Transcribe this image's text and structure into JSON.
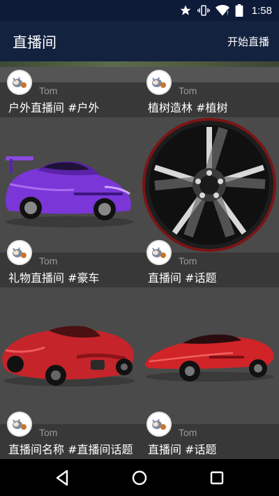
{
  "status_bar": {
    "time": "1:58",
    "icons": [
      "star-icon",
      "vibrate-icon",
      "wifi-icon",
      "battery-icon"
    ]
  },
  "app_bar": {
    "title": "直播间",
    "action_label": "开始直播"
  },
  "rooms": [
    {
      "author": "Tom",
      "title": "户外直播间 #户外",
      "image": "outdoor-scene"
    },
    {
      "author": "Tom",
      "title": "植树造林 #植树",
      "image": "tree-planting"
    },
    {
      "author": "Tom",
      "title": "礼物直播间 #豪车",
      "image": "purple-sports-car"
    },
    {
      "author": "Tom",
      "title": "直播间 #话题",
      "image": "car-wheel"
    },
    {
      "author": "Tom",
      "title": "直播间名称 #直播间话题",
      "image": "red-concept-car-rear"
    },
    {
      "author": "Tom",
      "title": "直播间 #话题",
      "image": "red-concept-car-side"
    }
  ],
  "nav_bar": [
    "back-icon",
    "home-icon",
    "recents-icon"
  ],
  "colors": {
    "status_bar": "#0d1a38",
    "app_bar": "#13223f",
    "background": "#4a4a4a",
    "meta_bar": "#373737",
    "author_text": "#9a9a9a"
  }
}
